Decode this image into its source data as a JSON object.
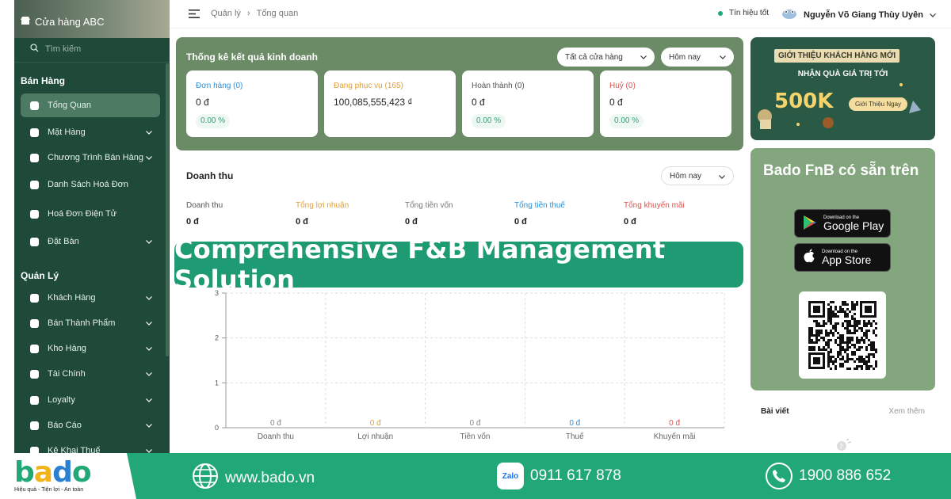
{
  "sidebar": {
    "store_name": "Cửa hàng ABC",
    "search_placeholder": "Tìm kiếm",
    "section_sales": "Bán Hàng",
    "section_manage": "Quản Lý",
    "items": [
      {
        "label": "Tổng Quan",
        "icon": "pie-chart-icon",
        "active": true
      },
      {
        "label": "Mặt Hàng",
        "icon": "cloche-icon",
        "chevron": true
      },
      {
        "label": "Chương Trình Bán Hàng",
        "icon": "trend-icon",
        "chevron": true
      },
      {
        "label": "Danh Sách Hoá Đơn",
        "icon": "dollar-doc-icon"
      },
      {
        "label": "Hoá Đơn Điện Tử",
        "icon": "wifi-doc-icon"
      },
      {
        "label": "Đặt Bàn",
        "icon": "calendar-icon",
        "chevron": true
      },
      {
        "label": "Khách Hàng",
        "icon": "users-icon",
        "chevron": true
      },
      {
        "label": "Bán Thành Phẩm",
        "icon": "box-icon",
        "chevron": true
      },
      {
        "label": "Kho Hàng",
        "icon": "warehouse-icon",
        "chevron": true
      },
      {
        "label": "Tài Chính",
        "icon": "wallet-icon",
        "chevron": true
      },
      {
        "label": "Loyalty",
        "icon": "medal-icon",
        "chevron": true
      },
      {
        "label": "Báo Cáo",
        "icon": "bar-chart-icon",
        "chevron": true
      },
      {
        "label": "Kê Khai Thuế",
        "icon": "tax-icon",
        "chevron": true
      }
    ]
  },
  "topbar": {
    "breadcrumb_root": "Quản lý",
    "breadcrumb_current": "Tổng quan",
    "signal": "Tín hiệu tốt",
    "user_name": "Nguyễn Võ Giang Thùy Uyên"
  },
  "stats": {
    "title": "Thống kê kết quả kinh doanh",
    "store_filter": "Tất cả cửa hàng",
    "date_filter": "Hôm nay",
    "cards": [
      {
        "label": "Đơn hàng (0)",
        "value": "0 đ",
        "pct": "0.00 %",
        "color": "#2a8fd8"
      },
      {
        "label": "Đang phục vụ (165)",
        "value": "100,085,555,423 ₫",
        "pct": "",
        "color": "#e0a03a"
      },
      {
        "label": "Hoàn thành (0)",
        "value": "0 đ",
        "pct": "0.00 %",
        "color": "#555555"
      },
      {
        "label": "Huỷ (0)",
        "value": "0 đ",
        "pct": "0.00 %",
        "color": "#d9534f"
      }
    ]
  },
  "revenue": {
    "title": "Doanh thu",
    "date_filter": "Hôm nay",
    "metrics": [
      {
        "label": "Doanh thu",
        "value": "0 đ",
        "color": "#555555"
      },
      {
        "label": "Tổng lợi nhuận",
        "value": "0 đ",
        "color": "#e0a03a"
      },
      {
        "label": "Tổng tiền vốn",
        "value": "0 đ",
        "color": "#777777"
      },
      {
        "label": "Tổng tiền thuế",
        "value": "0 đ",
        "color": "#2a8fd8"
      },
      {
        "label": "Tổng khuyến mãi",
        "value": "0 đ",
        "color": "#d9534f"
      }
    ]
  },
  "banner": "Comprehensive F&B Management Solution",
  "chart_data": {
    "type": "bar",
    "categories": [
      "Doanh thu",
      "Lợi nhuận",
      "Tiền vốn",
      "Thuế",
      "Khuyến mãi"
    ],
    "values": [
      0,
      0,
      0,
      0,
      0
    ],
    "data_labels": [
      "0 đ",
      "0 đ",
      "0 đ",
      "0 đ",
      "0 đ"
    ],
    "label_colors": [
      "#888888",
      "#e0a03a",
      "#888888",
      "#2a8fd8",
      "#d9534f"
    ],
    "yticks": [
      "0",
      "1",
      "2",
      "3"
    ],
    "ylim": [
      0,
      3
    ],
    "grid": true
  },
  "promo": {
    "tag": "GIỚI THIỆU KHÁCH HÀNG MỚI",
    "subtitle": "NHẬN QUÀ GIÁ TRỊ TỚI",
    "amount": "500K",
    "button": "Giới Thiệu Ngay"
  },
  "app": {
    "heading": "Bado FnB có sẵn trên",
    "google_small": "Download on the",
    "google_large": "Google Play",
    "apple_small": "Download on the",
    "apple_large": "App Store"
  },
  "posts": {
    "title": "Bài viết",
    "more": "Xem thêm"
  },
  "footer": {
    "slogan": "Hiệu quả - Tiện lợi - An toàn",
    "website": "www.bado.vn",
    "zalo_label": "Zalo",
    "phone1": "0911 617 878",
    "phone2": "1900 886 652"
  }
}
